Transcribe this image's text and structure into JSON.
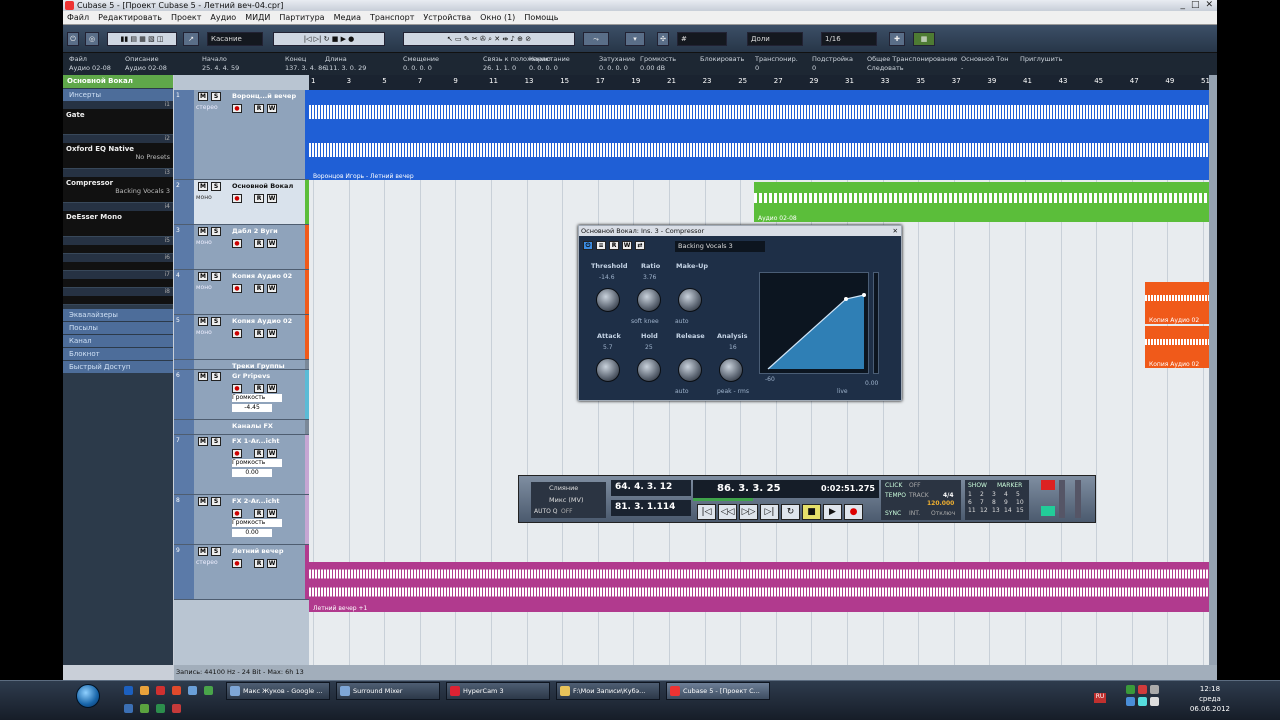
{
  "app": {
    "title": "Cubase 5 - [Проект Cubase 5 - Летний веч-04.cpr]",
    "window_buttons": [
      "_",
      "□",
      "✕"
    ]
  },
  "menu": [
    "Файл",
    "Редактировать",
    "Проект",
    "Аудио",
    "МИДИ",
    "Партитура",
    "Медиа",
    "Транспорт",
    "Устройства",
    "Окно (1)",
    "Помощь"
  ],
  "toolbar": {
    "automation_mode": "Касание",
    "grid_type": "Доли",
    "quantize": "1/16"
  },
  "infoline": {
    "columns": [
      {
        "label": "Файл",
        "value": "Аудио 02-08"
      },
      {
        "label": "Описание",
        "value": "Аудио 02-08"
      },
      {
        "label": "Начало",
        "value": "25. 4. 4. 59"
      },
      {
        "label": "Конец",
        "value": "137. 3. 4. 86"
      },
      {
        "label": "Длина",
        "value": "111. 3. 0. 29"
      },
      {
        "label": "Смещение",
        "value": "0. 0. 0. 0"
      },
      {
        "label": "Связь к положению",
        "value": "26. 1. 1. 0"
      },
      {
        "label": "Нарастание",
        "value": "0. 0. 0. 0"
      },
      {
        "label": "Затухание",
        "value": "0. 0. 0. 0"
      },
      {
        "label": "Громкость",
        "value": "0.00 dB"
      },
      {
        "label": "Блокировать",
        "value": ""
      },
      {
        "label": "Транспонир.",
        "value": "0"
      },
      {
        "label": "Подстройка",
        "value": "0"
      },
      {
        "label": "Общее Транспонирование",
        "value": "Следовать"
      },
      {
        "label": "Основной Тон",
        "value": "-"
      },
      {
        "label": "Приглушить",
        "value": ""
      }
    ]
  },
  "inspector": {
    "track_name": "Основной Вокал",
    "section_inserts": "Инсерты",
    "inserts": [
      {
        "slot": "i1",
        "name": "Gate",
        "preset": ""
      },
      {
        "slot": "i2",
        "name": "Oxford EQ Native",
        "preset": "No Presets"
      },
      {
        "slot": "i3",
        "name": "Compressor",
        "preset": "Backing Vocals 3"
      },
      {
        "slot": "i4",
        "name": "DeEsser Mono",
        "preset": ""
      },
      {
        "slot": "i5",
        "name": "",
        "preset": ""
      },
      {
        "slot": "i6",
        "name": "",
        "preset": ""
      },
      {
        "slot": "i7",
        "name": "",
        "preset": ""
      },
      {
        "slot": "i8",
        "name": "",
        "preset": ""
      }
    ],
    "sections": [
      "Эквалайзеры",
      "Посылы",
      "Канал",
      "Блокнот",
      "Быстрый Доступ"
    ]
  },
  "tracks": [
    {
      "num": "1",
      "name": "Воронц...й вечер",
      "type": "стерео"
    },
    {
      "num": "2",
      "name": "Основной Вокал",
      "type": "моно"
    },
    {
      "num": "3",
      "name": "Дабл 2 Вуги",
      "type": "моно"
    },
    {
      "num": "4",
      "name": "Копия Аудио 02",
      "type": "моно"
    },
    {
      "num": "5",
      "name": "Копия Аудио 02",
      "type": "моно"
    },
    {
      "num": "",
      "name": "Треки Группы",
      "type": ""
    },
    {
      "num": "6",
      "name": "Gr Pripevs",
      "type": "",
      "param": "Громкость",
      "value": "-4.45"
    },
    {
      "num": "",
      "name": "Каналы FX",
      "type": ""
    },
    {
      "num": "7",
      "name": "FX 1-Ar...icht",
      "type": "",
      "param": "Громкость",
      "value": "0.00"
    },
    {
      "num": "8",
      "name": "FX 2-Ar...icht",
      "type": "",
      "param": "Громкость",
      "value": "0.00"
    },
    {
      "num": "9",
      "name": "Летний вечер",
      "type": "стерео"
    }
  ],
  "ruler": {
    "ticks": [
      "1",
      "3",
      "5",
      "7",
      "9",
      "11",
      "13",
      "15",
      "17",
      "19",
      "21",
      "23",
      "25",
      "27",
      "29",
      "31",
      "33",
      "35",
      "37",
      "39",
      "41",
      "43",
      "45",
      "47",
      "49",
      "51"
    ]
  },
  "events": {
    "ev1": "Воронцов Игорь - Летний вечер",
    "ev2": "Аудио 02-08",
    "ev4": "Копия Аудио 02",
    "ev5": "Копия Аудио 02",
    "ev9": "Летний вечер +1"
  },
  "plugin": {
    "title": "Основной Вокал: Ins. 3 - Compressor",
    "preset": "Backing Vocals 3",
    "threshold_label": "Threshold",
    "threshold_value": "-14.6",
    "ratio_label": "Ratio",
    "ratio_value": "3.76",
    "makeup_label": "Make-Up",
    "softknee": "soft knee",
    "auto": "auto",
    "attack_label": "Attack",
    "attack_value": "5.7",
    "hold_label": "Hold",
    "hold_value": "25",
    "release_label": "Release",
    "analysis_label": "Analysis",
    "analysis_value": "16",
    "auto2": "auto",
    "peakrms": "peak - rms",
    "live": "live",
    "graph_min": "-60",
    "graph_max": "0.00",
    "buttons": [
      "R",
      "W"
    ]
  },
  "transport": {
    "mode1": "Слияние",
    "mode2": "Микс (MV)",
    "auto_q": "AUTO Q",
    "auto_q_state": "OFF",
    "left_locator": "64. 4. 3. 12",
    "right_locator": "81. 3. 1.114",
    "position_bars": "86. 3. 3. 25",
    "position_time": "0:02:51.275",
    "click": "CLICK",
    "click_state": "OFF",
    "tempo_label": "TEMPO",
    "track": "TRACK",
    "signature": "4/4",
    "tempo": "120.000",
    "sync": "SYNC",
    "int": "INT.",
    "sync_state": "Отключ",
    "show": "SHOW",
    "marker": "MARKER",
    "marker_nums": [
      "1",
      "2",
      "3",
      "4",
      "5",
      "6",
      "7",
      "8",
      "9",
      "10",
      "11",
      "12",
      "13",
      "14",
      "15"
    ]
  },
  "status": "Запись: 44100 Hz - 24 Bit - Max: 6h 13",
  "taskbar": {
    "tasks": [
      "Макс Жуков - Google ...",
      "Surround Mixer",
      "HyperCam 3",
      "F:\\Мои Записи\\Кубэ...",
      "Cubase 5 - [Проект C..."
    ],
    "time": "12:18",
    "day": "среда",
    "date": "06.06.2012",
    "lang": "RU"
  },
  "colors": {
    "track1": "#1f5fd6",
    "track2": "#5bbe3a",
    "track45": "#f05a1a",
    "track9": "#b13a8e",
    "group": "#5bbbd6",
    "fx": "#c6a6d3"
  }
}
